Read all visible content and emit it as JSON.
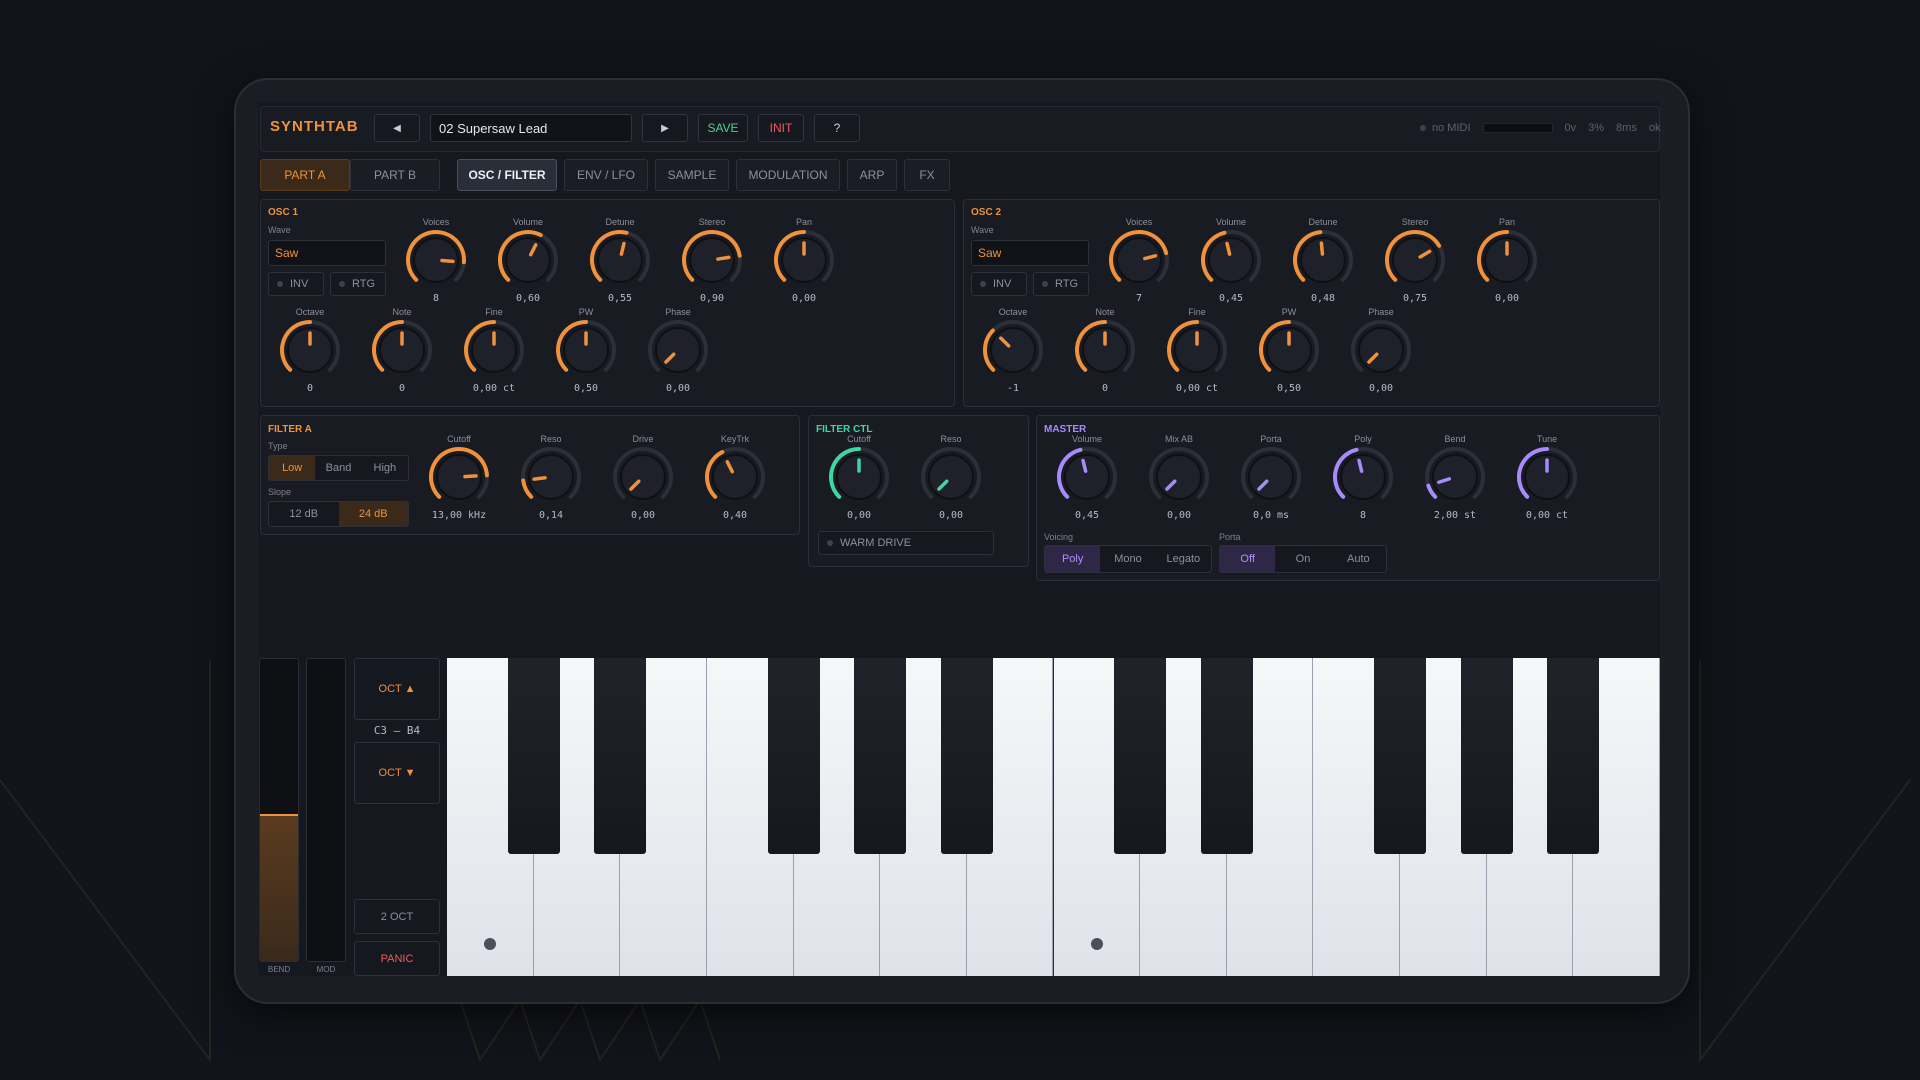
{
  "app": {
    "title": "SYNTHTAB"
  },
  "colors": {
    "accent": "#f0913b",
    "green": "#3fd6a4",
    "purple": "#a78bfa",
    "panic": "#f05a5a",
    "save": "#4cd18b",
    "init": "#f05a5a"
  },
  "toolbar": {
    "prev": "◀",
    "preset": "02 Supersaw Lead",
    "next": "▶",
    "save": "SAVE",
    "init": "INIT",
    "help": "?"
  },
  "status": {
    "midi": "no MIDI",
    "volt": "0v",
    "cpu": "3%",
    "latency": "8ms",
    "state": "ok"
  },
  "parts": [
    "PART A",
    "PART B"
  ],
  "tabs": [
    "OSC / FILTER",
    "ENV / LFO",
    "SAMPLE",
    "MODULATION",
    "ARP",
    "FX"
  ],
  "osc1": {
    "title": "OSC 1",
    "wave_label": "Wave",
    "wave": "Saw",
    "inv": "INV",
    "rtg": "RTG",
    "knobs": [
      {
        "label": "Voices",
        "value": "8",
        "level": 0.85
      },
      {
        "label": "Volume",
        "value": "0,60",
        "level": 0.6
      },
      {
        "label": "Detune",
        "value": "0,55",
        "level": 0.55
      },
      {
        "label": "Stereo",
        "value": "0,90",
        "level": 0.8
      },
      {
        "label": "Pan",
        "value": "0,00",
        "level": 0.5
      },
      {
        "label": "Octave",
        "value": "0",
        "level": 0.5
      },
      {
        "label": "Note",
        "value": "0",
        "level": 0.5
      },
      {
        "label": "Fine",
        "value": "0,00 ct",
        "level": 0.5
      },
      {
        "label": "PW",
        "value": "0,50",
        "level": 0.5
      },
      {
        "label": "Phase",
        "value": "0,00",
        "level": 0.0
      }
    ]
  },
  "osc2": {
    "title": "OSC 2",
    "wave_label": "Wave",
    "wave": "Saw",
    "inv": "INV",
    "rtg": "RTG",
    "knobs": [
      {
        "label": "Voices",
        "value": "7",
        "level": 0.78
      },
      {
        "label": "Volume",
        "value": "0,45",
        "level": 0.45
      },
      {
        "label": "Detune",
        "value": "0,48",
        "level": 0.48
      },
      {
        "label": "Stereo",
        "value": "0,75",
        "level": 0.72
      },
      {
        "label": "Pan",
        "value": "0,00",
        "level": 0.5
      },
      {
        "label": "Octave",
        "value": "-1",
        "level": 0.33
      },
      {
        "label": "Note",
        "value": "0",
        "level": 0.5
      },
      {
        "label": "Fine",
        "value": "0,00 ct",
        "level": 0.5
      },
      {
        "label": "PW",
        "value": "0,50",
        "level": 0.5
      },
      {
        "label": "Phase",
        "value": "0,00",
        "level": 0.0
      }
    ]
  },
  "filter_a": {
    "title": "FILTER A",
    "type_label": "Type",
    "types": [
      "Low",
      "Band",
      "High"
    ],
    "slope_label": "Slope",
    "slopes": [
      "12 dB",
      "24 dB"
    ],
    "knobs": [
      {
        "label": "Cutoff",
        "value": "13,00 kHz",
        "level": 0.82
      },
      {
        "label": "Reso",
        "value": "0,14",
        "level": 0.14
      },
      {
        "label": "Drive",
        "value": "0,00",
        "level": 0.0
      },
      {
        "label": "KeyTrk",
        "value": "0,40",
        "level": 0.4
      }
    ]
  },
  "filter_ctl": {
    "title": "FILTER CTL",
    "knobs": [
      {
        "label": "Cutoff",
        "value": "0,00",
        "level": 0.5
      },
      {
        "label": "Reso",
        "value": "0,00",
        "level": 0.0
      }
    ],
    "warm": "WARM DRIVE"
  },
  "master": {
    "title": "MASTER",
    "knobs": [
      {
        "label": "Volume",
        "value": "0,45",
        "level": 0.45
      },
      {
        "label": "Mix AB",
        "value": "0,00",
        "level": 0.0
      },
      {
        "label": "Porta",
        "value": "0,0 ms",
        "level": 0.0
      },
      {
        "label": "Poly",
        "value": "8",
        "level": 0.45
      },
      {
        "label": "Bend",
        "value": "2,00 st",
        "level": 0.1
      },
      {
        "label": "Tune",
        "value": "0,00 ct",
        "level": 0.5
      }
    ],
    "voicing_label": "Voicing",
    "voicing": [
      "Poly",
      "Mono",
      "Legato"
    ],
    "porta_label": "Porta",
    "porta": [
      "Off",
      "On",
      "Auto"
    ]
  },
  "keys_panel": {
    "oct_up": "OCT ▲",
    "range": "C3 – B4",
    "oct_down": "OCT ▼",
    "two_oct": "2 OCT",
    "panic": "PANIC",
    "bend": "BEND",
    "mod": "MOD",
    "bend_level": 0.48
  }
}
